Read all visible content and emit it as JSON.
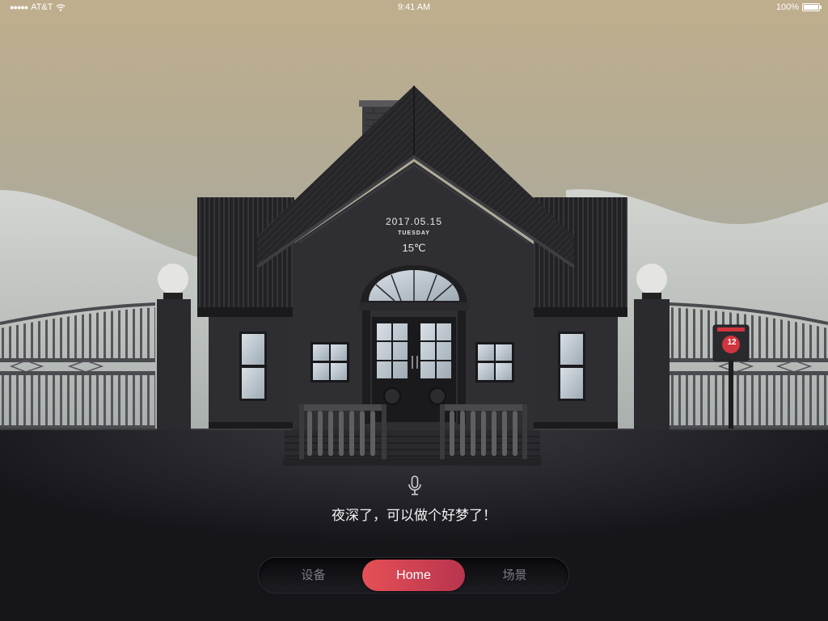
{
  "status_bar": {
    "carrier": "AT&T",
    "time": "9:41 AM",
    "battery": "100%"
  },
  "house_display": {
    "date": "2017.05.15",
    "weekday": "TUESDAY",
    "temperature": "15℃"
  },
  "mailbox": {
    "number": "12"
  },
  "voice": {
    "icon": "microphone-icon",
    "message": "夜深了，可以做个好梦了！"
  },
  "tabs": {
    "devices": "设备",
    "home": "Home",
    "scenes": "场景",
    "active": "home"
  },
  "colors": {
    "sky_top": "#bfae8d",
    "ground": "#16151a",
    "accent": "#e04a54",
    "house": "#2f2f33"
  }
}
